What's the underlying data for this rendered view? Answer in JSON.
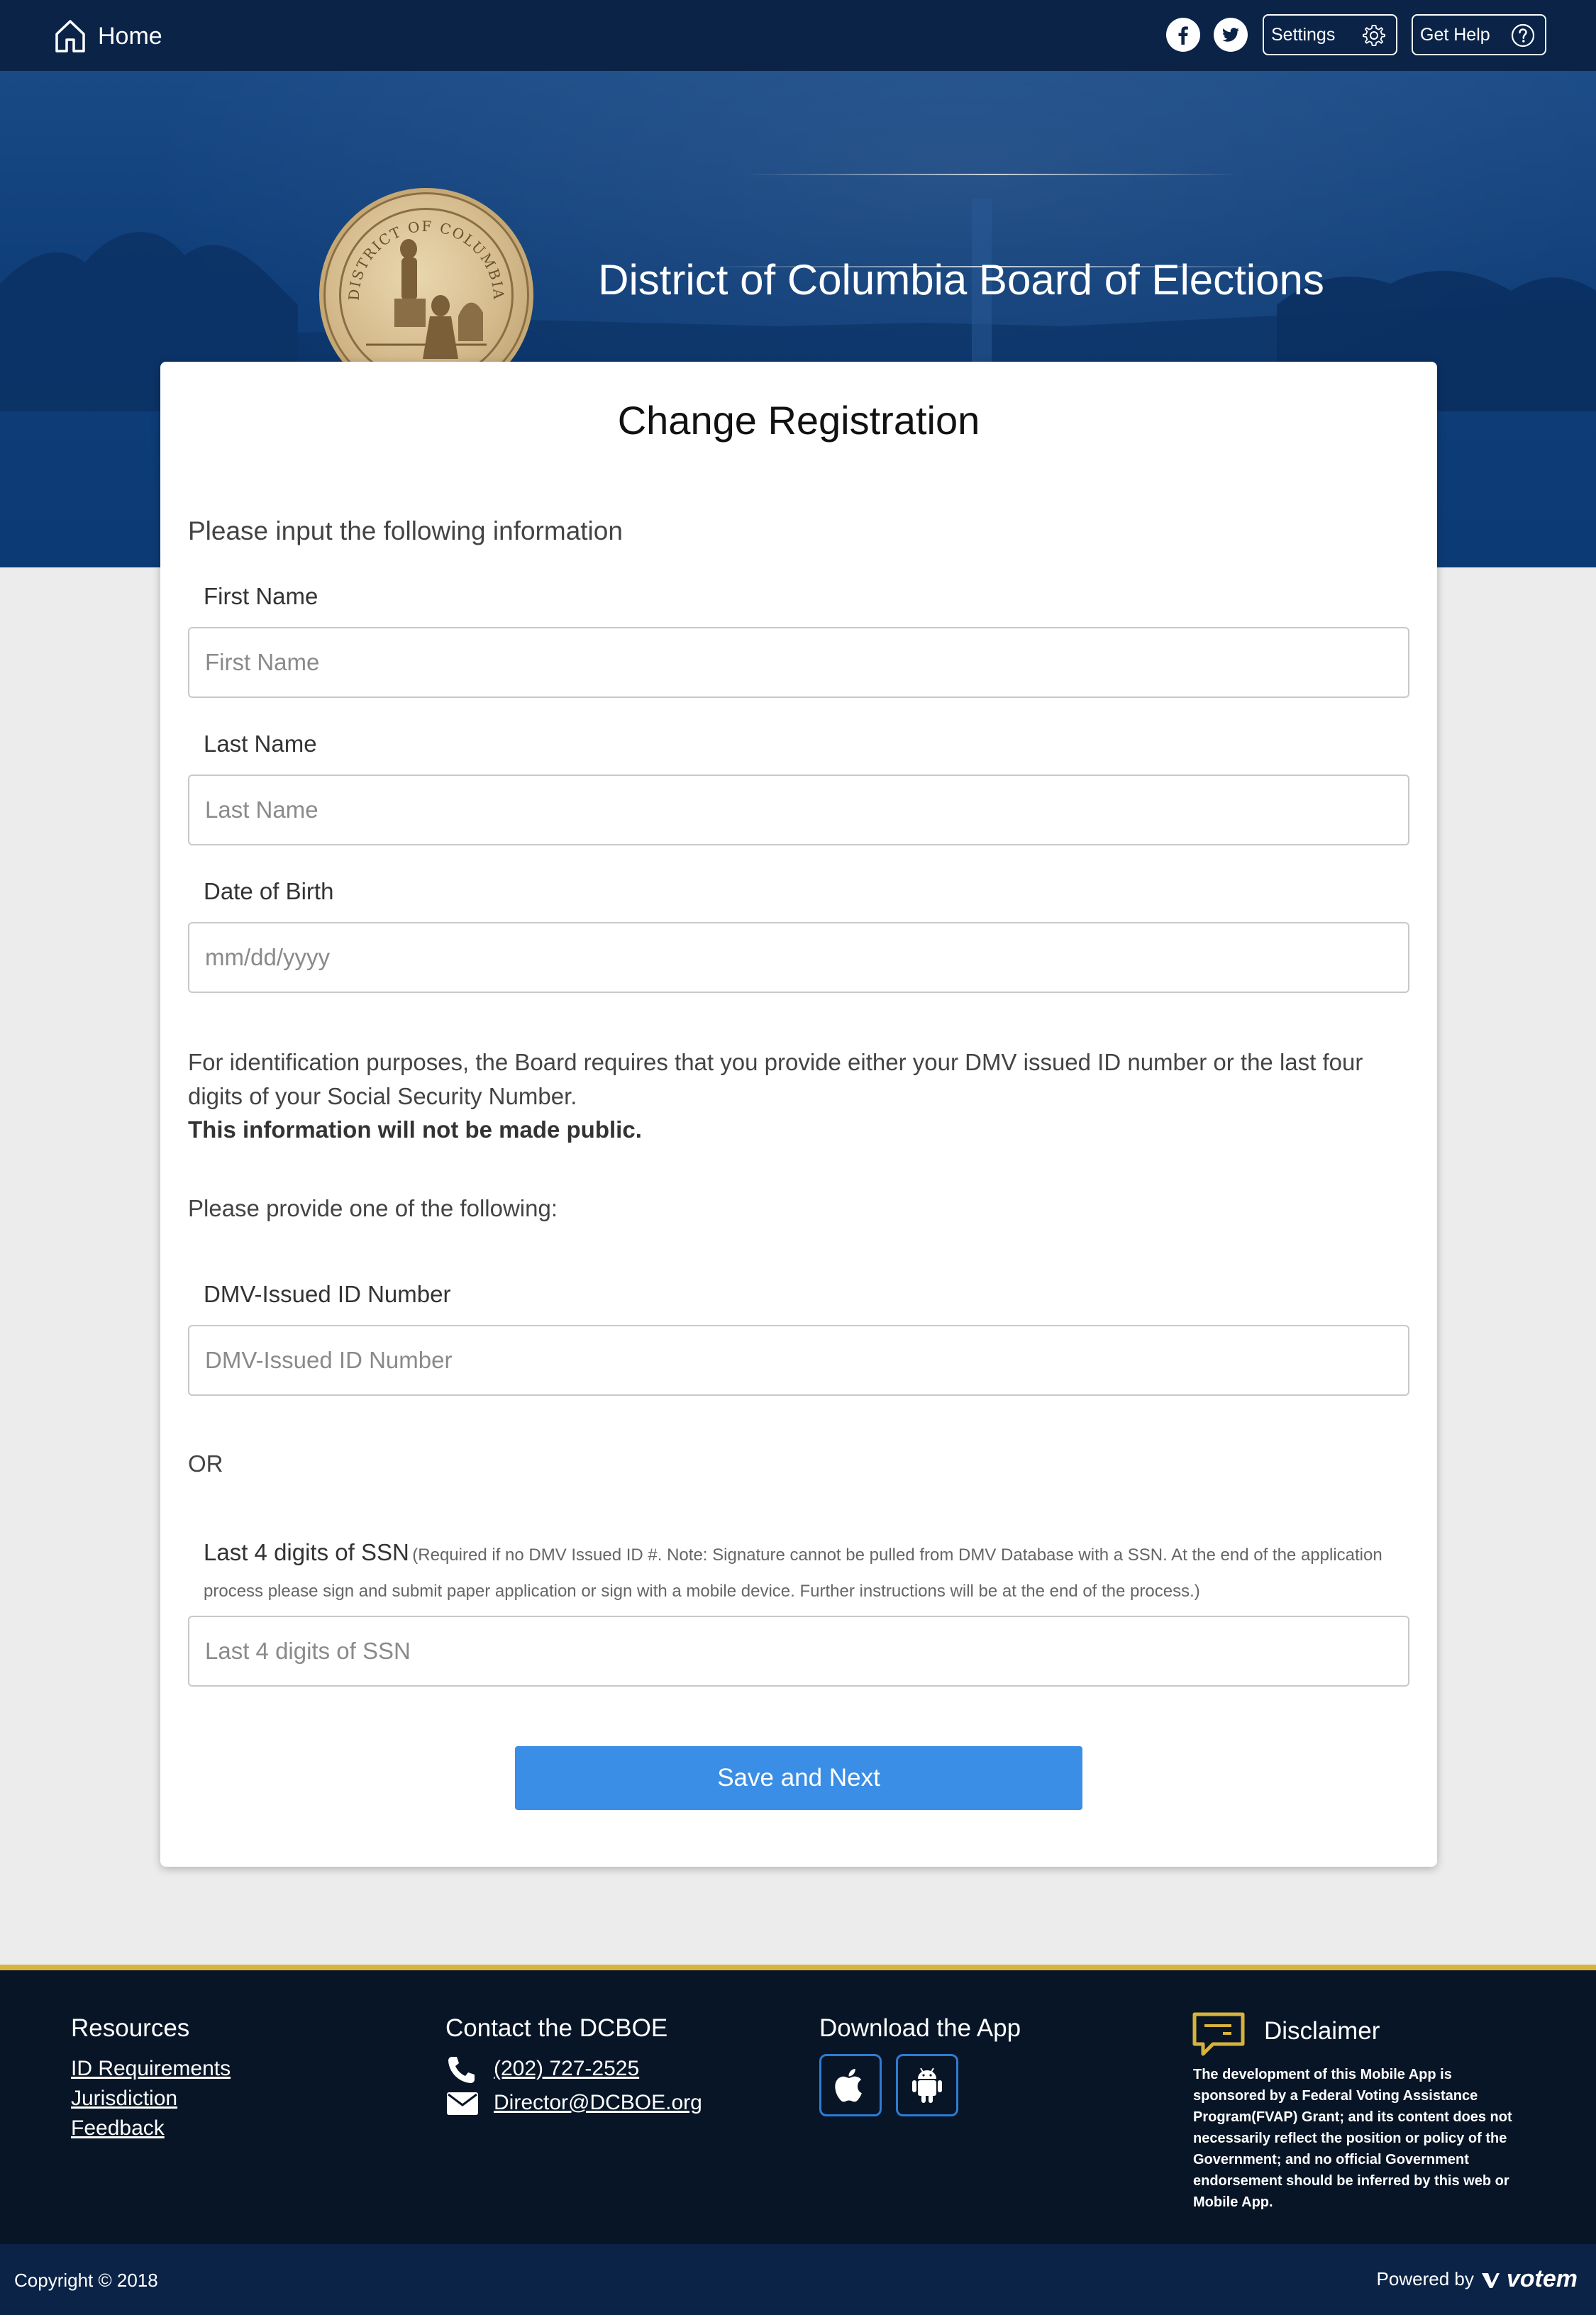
{
  "nav": {
    "home_label": "Home",
    "settings_label": "Settings",
    "help_label": "Get Help",
    "icons": [
      "home-icon",
      "facebook-icon",
      "twitter-icon",
      "gear-icon",
      "question-icon"
    ]
  },
  "hero": {
    "title": "District of Columbia Board of Elections",
    "seal_text": "DISTRICT OF COLUMBIA"
  },
  "form": {
    "title": "Change Registration",
    "intro": "Please input the following information",
    "first_name": {
      "label": "First Name",
      "placeholder": "First Name",
      "value": ""
    },
    "last_name": {
      "label": "Last Name",
      "placeholder": "Last Name",
      "value": ""
    },
    "dob": {
      "label": "Date of Birth",
      "placeholder": "mm/dd/yyyy",
      "value": ""
    },
    "id_paragraph": "For identification purposes, the Board requires that you provide either your DMV issued ID number or the last four digits of your Social Security Number.",
    "id_public_note": "This information will not be made public.",
    "provide_one": "Please provide one of the following:",
    "dmv": {
      "label": "DMV-Issued ID Number",
      "placeholder": "DMV-Issued ID Number",
      "value": ""
    },
    "or_label": "OR",
    "ssn": {
      "label": "Last 4 digits of SSN",
      "note": "(Required if no DMV Issued ID #. Note: Signature cannot be pulled from DMV Database with a SSN. At the end of the application process please sign and submit paper application or sign with a mobile device. Further instructions will be at the end of the process.)",
      "placeholder": "Last 4 digits of SSN",
      "value": ""
    },
    "submit_label": "Save and Next"
  },
  "footer": {
    "resources_heading": "Resources",
    "resources_links": [
      "ID Requirements",
      "Jurisdiction",
      "Feedback"
    ],
    "contact_heading": "Contact the DCBOE",
    "phone": "(202) 727-2525",
    "email": "Director@DCBOE.org",
    "download_heading": "Download the App",
    "disclaimer_heading": "Disclaimer",
    "disclaimer_text": "The development of this Mobile App is sponsored by a Federal Voting Assistance Program(FVAP) Grant; and its content does not necessarily reflect the position or policy of the Government; and no official Government endorsement should be inferred by this web or Mobile App.",
    "copyright": "Copyright © 2018",
    "powered_by": "Powered by",
    "brand": "votem"
  },
  "colors": {
    "nav_bg": "#0a2347",
    "hero_bg": "#0e3d78",
    "accent_button": "#3a8ee6",
    "footer_gold": "#d7b23d",
    "footer_bg": "#071526"
  }
}
